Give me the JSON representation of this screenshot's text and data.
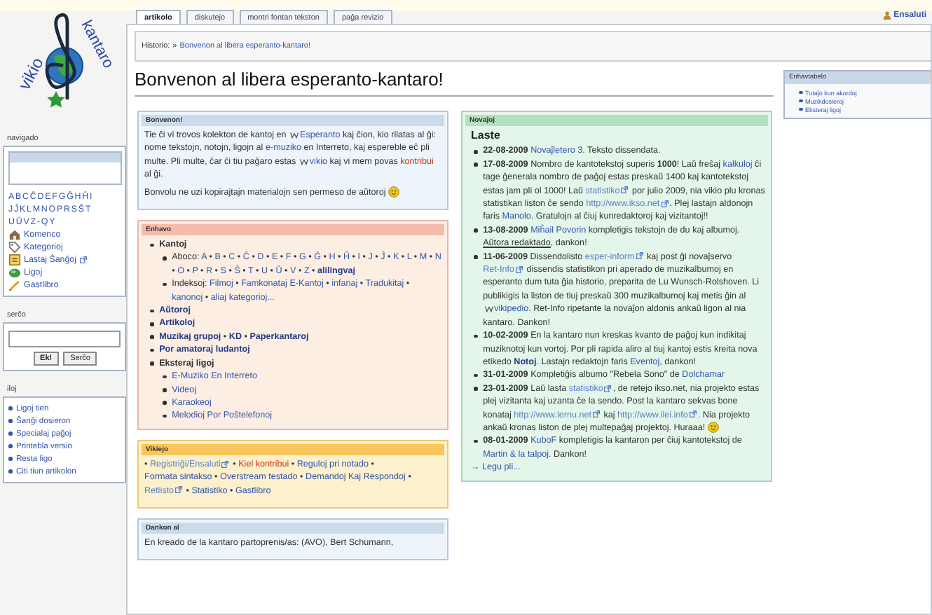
{
  "logo": {
    "words": [
      "vikio",
      "kantaro"
    ]
  },
  "sidebar": {
    "navigation": {
      "title": "navigado",
      "alphabet": [
        "ABCĈDEFGĜHĤI",
        "JĴKLMNOPRSŜT",
        "UŬVZ-QY"
      ],
      "links": [
        {
          "label": "Komenco",
          "kind": "house",
          "external": false
        },
        {
          "label": "Kategorioj",
          "kind": "tag",
          "external": false
        },
        {
          "label": "Lastaj Ŝanĝoj",
          "kind": "page",
          "external": true
        },
        {
          "label": "Ligoj",
          "kind": "globe",
          "external": false
        },
        {
          "label": "Gastlibro",
          "kind": "pencil",
          "external": false
        }
      ]
    },
    "search": {
      "title": "serĉo",
      "buttons": [
        "Ek!",
        "Serĉo"
      ]
    },
    "tools": {
      "title": "iloj",
      "items": [
        "Ligoj tien",
        "Ŝanĝi dosieron",
        "Specialaj paĝoj",
        "Printebla versio",
        "Resta ligo",
        "Citi tiun artikolon"
      ]
    }
  },
  "tabs": [
    {
      "label": "artikolo",
      "selected": true
    },
    {
      "label": "diskutejo",
      "selected": false
    },
    {
      "label": "montri fontan tekston",
      "selected": false
    },
    {
      "label": "paĝa revizio",
      "selected": false
    }
  ],
  "user_link": "Ensaluti",
  "breadcrumb": {
    "label": "Historio:",
    "separator": "»",
    "link": "Bonvenon al libera esperanto-kantaro!"
  },
  "title": "Bonvenon al libera esperanto-kantaro!",
  "toc": {
    "title": "Enhavtabelo",
    "items": [
      "Tutaĵo kun akordoj",
      "Muzikdosieroj",
      "Eksteraj ligoj"
    ]
  },
  "boxes": [
    {
      "kind": "blue",
      "title": "Bonvenon!",
      "paragraphs": [
        [
          "Tie ĉi vi trovos kolekton de kantoj en ",
          {
            "kind": "wiki",
            "text": "Esperanto"
          },
          " kaj ĉion, kio rilatas al ĝi: nome tekstojn, notojn, ligojn al ",
          {
            "kind": "link",
            "text": "e-muziko"
          },
          " en Interreto, kaj espereble eĉ pli multe. Pli multe, ĉar ĉi tiu paĝaro estas ",
          {
            "kind": "wiki",
            "text": "vikio"
          },
          " kaj vi mem povas ",
          {
            "kind": "new",
            "text": "kontribui"
          },
          " al ĝi."
        ],
        [
          "Bonvolu ne uzi kopirajtajn materialojn sen permeso de aŭtoroj ",
          {
            "kind": "smiley"
          }
        ]
      ]
    },
    {
      "kind": "red",
      "title": "Enhavo",
      "list": [
        {
          "segs": [
            {
              "kind": "bold",
              "text": "Kantoj"
            }
          ],
          "children": [
            {
              "segs": [
                "Aboco: ",
                {
                  "kind": "link",
                  "text": "A"
                },
                " • ",
                {
                  "kind": "link",
                  "text": "B"
                },
                " • ",
                {
                  "kind": "link",
                  "text": "C"
                },
                " • ",
                {
                  "kind": "link",
                  "text": "Ĉ"
                },
                " • ",
                {
                  "kind": "link",
                  "text": "D"
                },
                " • ",
                {
                  "kind": "link",
                  "text": "E"
                },
                " • ",
                {
                  "kind": "link",
                  "text": "F"
                },
                " • ",
                {
                  "kind": "link",
                  "text": "G"
                },
                " • ",
                {
                  "kind": "link",
                  "text": "Ĝ"
                },
                " • ",
                {
                  "kind": "link",
                  "text": "H"
                },
                " • ",
                {
                  "kind": "link",
                  "text": "Ĥ"
                },
                " • ",
                {
                  "kind": "link",
                  "text": "I"
                },
                " • ",
                {
                  "kind": "link",
                  "text": "J"
                },
                " • ",
                {
                  "kind": "link",
                  "text": "Ĵ"
                },
                " • ",
                {
                  "kind": "link",
                  "text": "K"
                },
                " • ",
                {
                  "kind": "link",
                  "text": "L"
                },
                " • ",
                {
                  "kind": "link",
                  "text": "M"
                },
                " • ",
                {
                  "kind": "link",
                  "text": "N"
                },
                " • ",
                {
                  "kind": "link",
                  "text": "O"
                },
                " • ",
                {
                  "kind": "link",
                  "text": "P"
                },
                " • ",
                {
                  "kind": "link",
                  "text": "R"
                },
                " • ",
                {
                  "kind": "link",
                  "text": "S"
                },
                " • ",
                {
                  "kind": "link",
                  "text": "Ŝ"
                },
                " • ",
                {
                  "kind": "link",
                  "text": "T"
                },
                " • ",
                {
                  "kind": "link",
                  "text": "U"
                },
                " • ",
                {
                  "kind": "link",
                  "text": "Ŭ"
                },
                " • ",
                {
                  "kind": "link",
                  "text": "V"
                },
                " • ",
                {
                  "kind": "link",
                  "text": "Z"
                },
                " • ",
                {
                  "kind": "boldlink",
                  "text": "alilingvaj"
                }
              ]
            },
            {
              "segs": [
                "Indeksoj: ",
                {
                  "kind": "link",
                  "text": "Filmoj"
                },
                " • ",
                {
                  "kind": "link",
                  "text": "Famkonataj E-Kantoj"
                },
                " • ",
                {
                  "kind": "link",
                  "text": "infanaj"
                },
                " • ",
                {
                  "kind": "link",
                  "text": "Tradukitaj"
                },
                " • ",
                {
                  "kind": "link",
                  "text": "kanonoj"
                },
                " • ",
                {
                  "kind": "link",
                  "text": "aliaj kategorioj..."
                }
              ]
            }
          ]
        },
        {
          "segs": [
            {
              "kind": "boldlink",
              "text": "Aŭtoroj"
            }
          ]
        },
        {
          "segs": [
            {
              "kind": "boldlink",
              "text": "Artikoloj"
            }
          ]
        },
        {
          "segs": [
            {
              "kind": "boldlink",
              "text": "Muzikaj grupoj"
            },
            " • ",
            {
              "kind": "boldlink",
              "text": "KD"
            },
            " • ",
            {
              "kind": "boldlink",
              "text": "Paperkantaroj"
            }
          ]
        },
        {
          "segs": [
            {
              "kind": "boldlink",
              "text": "Por amatoraj ludantoj"
            }
          ]
        },
        {
          "segs": [
            {
              "kind": "bold",
              "text": "Eksteraj ligoj"
            }
          ],
          "children": [
            {
              "segs": [
                {
                  "kind": "link",
                  "text": "E-Muziko En Interreto"
                }
              ]
            },
            {
              "segs": [
                {
                  "kind": "link",
                  "text": "Videoj"
                }
              ]
            },
            {
              "segs": [
                {
                  "kind": "link",
                  "text": "Karaokeoj"
                }
              ]
            },
            {
              "segs": [
                {
                  "kind": "link",
                  "text": "Melodioj Por Poŝtelefonoj"
                }
              ]
            }
          ]
        }
      ]
    },
    {
      "kind": "orange",
      "title": "Vikiejo",
      "paragraphs": [
        [
          "• ",
          {
            "kind": "ext",
            "text": "Registriĝi/Ensaluti"
          },
          " • ",
          {
            "kind": "new",
            "text": "Kiel kontribui"
          },
          " • ",
          {
            "kind": "link",
            "text": "Reguloj pri notado"
          },
          " • ",
          {
            "kind": "link",
            "text": "Formata sintakso"
          },
          " • ",
          {
            "kind": "link",
            "text": "Overstream testado"
          },
          " • ",
          {
            "kind": "link",
            "text": "Demandoj Kaj Respondoj"
          },
          " • ",
          {
            "kind": "ext",
            "text": "Retlisto"
          },
          " • ",
          {
            "kind": "link",
            "text": "Statistiko"
          },
          " • ",
          {
            "kind": "link",
            "text": "Gastlibro"
          }
        ]
      ]
    },
    {
      "kind": "blue",
      "title": "Dankon al",
      "paragraphs": [
        [
          "En kreado de la kantaro partoprenis/as: (AVO), Bert Schumann,"
        ]
      ]
    }
  ],
  "news": {
    "title": "Novaĵoj",
    "heading": "Laste",
    "items": [
      {
        "date": "22-08-2009",
        "segs": [
          {
            "kind": "link",
            "text": "Novaĵletero 3"
          },
          ". Teksto dissendata."
        ]
      },
      {
        "date": "17-08-2009",
        "segs": [
          "Nombro de kantotekstoj superis ",
          {
            "kind": "bold",
            "text": "1000"
          },
          "! Laŭ freŝaj ",
          {
            "kind": "link",
            "text": "kalkuloj"
          },
          " ĉi tage ĝenerala nombro de paĝoj estas preskaŭ 1400 kaj kantotekstoj estas jam pli ol 1000! Laŭ ",
          {
            "kind": "ext",
            "text": "statistiko"
          },
          " por julio 2009, nia vikio plu kronas statistikan liston ĉe sendo ",
          {
            "kind": "ext",
            "text": "http://www.ikso.net"
          },
          ". Plej lastajn aldonojn faris ",
          {
            "kind": "link",
            "text": "Manolo"
          },
          ". Gratulojn al ĉiuj kunredaktoroj kaj vizitantoj!!"
        ]
      },
      {
        "date": "13-08-2009",
        "segs": [
          {
            "kind": "link",
            "text": "Miĥail Povorin"
          },
          " kompletigis tekstojn de du kaj albumoj. ",
          {
            "kind": "u",
            "text": "Aŭtora redaktado"
          },
          ", dankon!"
        ]
      },
      {
        "date": "11-06-2009",
        "segs": [
          "Dissendolisto ",
          {
            "kind": "ext",
            "text": "esper-inform"
          },
          " kaj post ĝi novaĵservo ",
          {
            "kind": "ext",
            "text": "Ret-Info"
          },
          " dissendis statistikon pri aperado de muzikalbumoj en esperanto dum tuta ĝia historio, preparita de Lu Wunsch-Rolshoven. Li publikigis la liston de tiuj preskaŭ 300 muzikalbumoj kaj metis ĝin al ",
          {
            "kind": "wiki",
            "text": "vikipedio"
          },
          ". Ret-Info ripetante la novaĵon aldonis ankaŭ ligon al nia kantaro. Dankon!"
        ]
      },
      {
        "date": "10-02-2009",
        "segs": [
          "En la kantaro nun kreskas kvanto de paĝoj kun indikitaj muziknotoj kun vortoj. Por pli rapida aliro al tiuj kantoj estis kreita nova etikedo ",
          {
            "kind": "boldlink",
            "text": "Notoj"
          },
          ". Lastajn redaktojn faris ",
          {
            "kind": "link",
            "text": "Eventoj"
          },
          ", dankon!"
        ]
      },
      {
        "date": "31-01-2009",
        "segs": [
          "Kompletiĝis albumo \"Rebela Sono\" de ",
          {
            "kind": "link",
            "text": "Dolchamar"
          }
        ]
      },
      {
        "date": "23-01-2009",
        "segs": [
          "Laŭ lasta ",
          {
            "kind": "ext",
            "text": "statistiko"
          },
          ", de retejo ikso.net, nia projekto estas plej vizitanta kaj uzanta ĉe la sendo. Post la kantaro sekvas bone konataj ",
          {
            "kind": "ext",
            "text": "http://www.lernu.net"
          },
          " kaj ",
          {
            "kind": "ext",
            "text": "http://www.ilei.info"
          },
          ". Nia projekto ankaŭ kronas liston de plej multepaĝaj projektoj. Huraaa! ",
          {
            "kind": "smiley"
          }
        ]
      },
      {
        "date": "08-01-2009",
        "segs": [
          {
            "kind": "link",
            "text": "KuboF"
          },
          " kompletigis la kantaron per ĉiuj kantotekstoj de ",
          {
            "kind": "link",
            "text": "Martin & la talpoj"
          },
          ". Dankon!"
        ]
      }
    ],
    "more": "→ Legu pli..."
  }
}
